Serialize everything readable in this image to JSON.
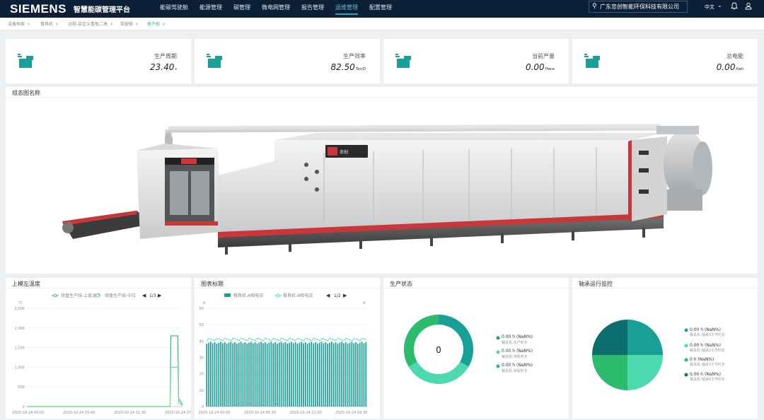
{
  "header": {
    "logo": "SIEMENS",
    "platform_title": "智慧能碳管理平台",
    "nav": [
      "能碳驾驶舱",
      "能源管理",
      "碳管理",
      "微电网管理",
      "报告管理",
      "运维管理",
      "配置管理"
    ],
    "active_nav": "运维管理",
    "company": "广东忠创智能环保科技有限公司",
    "language": "中文"
  },
  "tabs": [
    {
      "label": "设备档案",
      "active": false
    },
    {
      "label": "餐具机",
      "active": false
    },
    {
      "label": "远程-自定义看板二高",
      "active": false
    },
    {
      "label": "驾驶舱",
      "active": false
    },
    {
      "label": "烘干机",
      "active": true
    }
  ],
  "kpis": [
    {
      "label": "生产周期",
      "value": "23.40",
      "unit": "s"
    },
    {
      "label": "生产效率",
      "value": "82.50",
      "unit": "Ton/D"
    },
    {
      "label": "当前产量",
      "value": "0.00",
      "unit": "Piece"
    },
    {
      "label": "总电能",
      "value": "0.00",
      "unit": "Kwh"
    }
  ],
  "diagram": {
    "title": "组态图名称",
    "machine_brand": "忠创"
  },
  "colors": {
    "teal": "#1a9e98",
    "mint": "#4dd9b0",
    "green": "#2dbb6e",
    "dark_teal": "#0d6e6e",
    "navy": "#0b2037"
  },
  "charts": {
    "temperature": {
      "title": "上模左温度",
      "legend": [
        "烘盘生产线-上层温度",
        "烘盘生产线-中位"
      ],
      "page": "1/3",
      "y_unit": "℃"
    },
    "chart_title": {
      "title": "图表标题",
      "legend": [
        "餐具机-A相电流",
        "餐具机-B相电流"
      ],
      "page": "1/2",
      "y_unit": "A",
      "y_unit_right": "A"
    },
    "production_status": {
      "title": "生产状态",
      "center": "0",
      "items": [
        {
          "value": "0.00 h (NaN%)",
          "label": "餐具机-生产时长"
        },
        {
          "value": "0.00 h (NaN%)",
          "label": "餐具机-待机时长"
        },
        {
          "value": "0.00 h (NaN%)",
          "label": "餐具机-保留时长"
        }
      ]
    },
    "bearing": {
      "title": "轴承运行监控",
      "items": [
        {
          "value": "0.00 h (NaN%)",
          "label": "餐具机-轴承1工作时长"
        },
        {
          "value": "0.00 h (NaN%)",
          "label": "餐具机-轴承2工作时长"
        },
        {
          "value": "0 h (NaN%)",
          "label": "餐具机-轴承3工作时长"
        },
        {
          "value": "0.00 h (NaN%)",
          "label": "餐具机-轴承4工作时长"
        }
      ]
    }
  },
  "chart_data": [
    {
      "type": "line",
      "title": "上模左温度",
      "ylabel": "℃",
      "ylim": [
        0,
        2500
      ],
      "yticks": [
        "2,500",
        "2,000",
        "1,500",
        "1,000",
        "500",
        "0"
      ],
      "xticks": [
        "2025-10-24 00:00",
        "2025-10-24 05:45",
        "2025-10-24 11:30",
        "2025-10-24 17:15"
      ],
      "series": [
        {
          "name": "烘盘生产线-上层温度",
          "x": [
            0,
            0.92,
            0.925,
            0.94,
            0.97,
            0.975,
            1
          ],
          "values": [
            0,
            0,
            1800,
            1800,
            1800,
            200,
            50
          ]
        },
        {
          "name": "烘盘生产线-中位",
          "x": [
            0,
            0.92,
            0.925,
            0.94,
            0.97,
            0.975,
            1
          ],
          "values": [
            0,
            0,
            1000,
            1000,
            1000,
            100,
            20
          ]
        }
      ]
    },
    {
      "type": "bar",
      "title": "图表标题",
      "ylabel": "A",
      "ylim": [
        0,
        60
      ],
      "yticks": [
        "60",
        "50",
        "40",
        "30",
        "20",
        "10",
        "0"
      ],
      "xticks": [
        "2025-10-24 00:00",
        "2025-10-24 05:30",
        "2025-10-24 11:00",
        "2025-10-24 16:30"
      ],
      "series": [
        {
          "name": "餐具机-A相电流",
          "approx_value": 39
        },
        {
          "name": "餐具机-B相电流",
          "approx_value": 41
        }
      ]
    }
  ]
}
